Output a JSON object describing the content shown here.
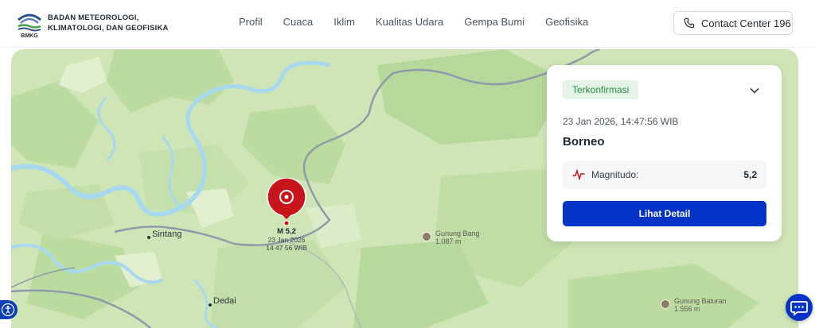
{
  "header": {
    "org_name_line1": "BADAN METEOROLOGI,",
    "org_name_line2": "KLIMATOLOGI, DAN GEOFISIKA",
    "logo_text": "BMKG",
    "nav": [
      "Profil",
      "Cuaca",
      "Iklim",
      "Kualitas Udara",
      "Gempa Bumi",
      "Geofisika"
    ],
    "contact_label": "Contact Center 196"
  },
  "map": {
    "places": [
      {
        "name": "Sintang"
      },
      {
        "name": "Dedai"
      }
    ],
    "mountains": [
      {
        "name": "Gunung Bang",
        "elevation": "1.087 m"
      },
      {
        "name": "Gunung Baluran",
        "elevation": "1.556 m"
      }
    ],
    "quake_marker": {
      "magnitude_label": "M 5,2",
      "date": "23 Jan 2026",
      "time": "14 47 56 WIB"
    }
  },
  "card": {
    "status_badge": "Terkonfirmasi",
    "datetime": "23 Jan 2026, 14:47:56 WIB",
    "region": "Borneo",
    "magnitude_label": "Magnitudo:",
    "magnitude_value": "5,2",
    "detail_button": "Lihat Detail"
  },
  "icons": {
    "phone": "phone-icon",
    "chevron": "chevron-down-icon",
    "pulse": "pulse-icon",
    "accessibility": "accessibility-icon",
    "chat": "chat-icon"
  },
  "colors": {
    "primary": "#0533c8",
    "quake_red": "#c8141b",
    "badge_bg": "#e3f3e5",
    "badge_text": "#2e8a45",
    "map_land": "#cfe5b6",
    "river": "#a6d8ef"
  }
}
